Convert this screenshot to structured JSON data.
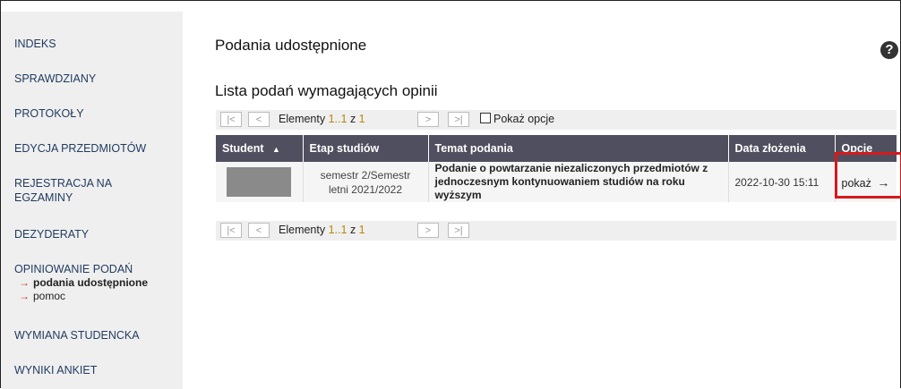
{
  "sidebar": {
    "items": [
      {
        "label": "INDEKS"
      },
      {
        "label": "SPRAWDZIANY"
      },
      {
        "label": "PROTOKOŁY"
      },
      {
        "label": "EDYCJA PRZEDMIOTÓW"
      },
      {
        "label": "REJESTRACJA NA EGZAMINY"
      },
      {
        "label": "DEZYDERATY"
      },
      {
        "label": "OPINIOWANIE PODAŃ",
        "subitems": [
          {
            "label": "podania udostępnione",
            "active": true
          },
          {
            "label": "pomoc",
            "active": false
          }
        ]
      },
      {
        "label": "WYMIANA STUDENCKA"
      },
      {
        "label": "WYNIKI ANKIET"
      }
    ]
  },
  "main": {
    "title": "Podania udostępnione",
    "help_icon": "question-circle-icon",
    "section_title": "Lista podań wymagających opinii",
    "pager": {
      "first": "|<",
      "prev": "<",
      "next": ">",
      "last": ">|",
      "elements_label": "Elementy",
      "range": "1..1",
      "of_label": "z",
      "total": "1",
      "show_options_label": "Pokaż opcje"
    },
    "table": {
      "headers": {
        "student": "Student",
        "sort_indicator": "▲",
        "stage": "Etap studiów",
        "topic": "Temat podania",
        "date": "Data złożenia",
        "options": "Opcje"
      },
      "rows": [
        {
          "stage": "semestr 2/Semestr letni 2021/2022",
          "topic": "Podanie o powtarzanie niezaliczonych przedmiotów z jednoczesnym kontynuowaniem studiów na roku wyższym",
          "date": "2022-10-30 15:11",
          "action": "pokaż",
          "action_arrow": "→"
        }
      ]
    },
    "colors": {
      "header_bg": "#4f4f5f",
      "highlight": "#d7191c",
      "link_arrow": "#c0392b"
    }
  }
}
